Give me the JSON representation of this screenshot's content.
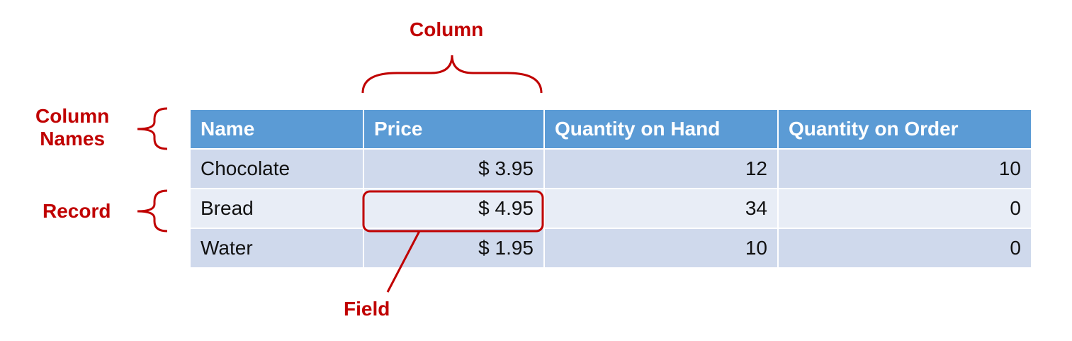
{
  "annotations": {
    "column": "Column",
    "column_names_line1": "Column",
    "column_names_line2": "Names",
    "record": "Record",
    "field": "Field"
  },
  "table": {
    "headers": [
      "Name",
      "Price",
      "Quantity on Hand",
      "Quantity on Order"
    ],
    "rows": [
      [
        "Chocolate",
        "$ 3.95",
        "12",
        "10"
      ],
      [
        "Bread",
        "$ 4.95",
        "34",
        "0"
      ],
      [
        "Water",
        "$ 1.95",
        "10",
        "0"
      ]
    ]
  },
  "colors": {
    "annotation": "#c00000",
    "header_bg": "#5b9bd5",
    "row_dark": "#cfd9ec",
    "row_light": "#e8edf6"
  }
}
